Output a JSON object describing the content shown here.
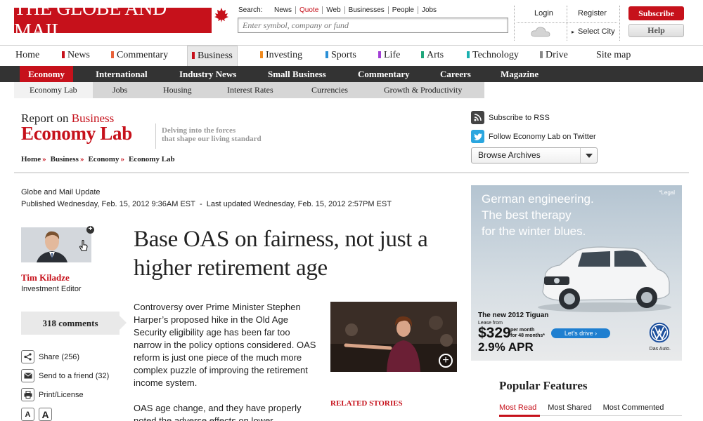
{
  "header": {
    "logo": "THE GLOBE AND MAIL",
    "search_label": "Search:",
    "search_tabs": [
      "News",
      "Quote",
      "Web",
      "Businesses",
      "People",
      "Jobs"
    ],
    "search_active": "Quote",
    "search_placeholder": "Enter symbol, company or fund",
    "login": "Login",
    "register": "Register",
    "select_city": "Select City",
    "subscribe": "Subscribe",
    "help": "Help"
  },
  "section_nav": {
    "items": [
      {
        "label": "Home"
      },
      {
        "label": "News",
        "color": "#c6111b"
      },
      {
        "label": "Commentary",
        "color": "#e8623a"
      },
      {
        "label": "Business",
        "color": "#c6111b"
      },
      {
        "label": "Investing",
        "color": "#f08a1e"
      },
      {
        "label": "Sports",
        "color": "#2a8fd6"
      },
      {
        "label": "Life",
        "color": "#a23fd6"
      },
      {
        "label": "Arts",
        "color": "#1fa67a"
      },
      {
        "label": "Technology",
        "color": "#1ab0b0"
      },
      {
        "label": "Drive",
        "color": "#888888"
      },
      {
        "label": "Site map"
      }
    ],
    "selected": "Business"
  },
  "sub_nav": {
    "items": [
      "Economy",
      "International",
      "Industry News",
      "Small Business",
      "Commentary",
      "Careers",
      "Magazine"
    ],
    "selected": "Economy"
  },
  "third_nav": {
    "items": [
      "Economy Lab",
      "Jobs",
      "Housing",
      "Interest Rates",
      "Currencies",
      "Growth & Productivity"
    ],
    "selected": "Economy Lab"
  },
  "page_header": {
    "report_on": "Report on",
    "business": "Business",
    "title": "Economy Lab",
    "tagline_1": "Delving into the forces",
    "tagline_2": "that shape our living standard",
    "breadcrumb": [
      "Home",
      "Business",
      "Economy",
      "Economy Lab"
    ],
    "rss": "Subscribe to RSS",
    "twitter": "Follow Economy Lab on Twitter",
    "archives": "Browse Archives"
  },
  "article": {
    "source": "Globe and Mail Update",
    "published": "Published Wednesday, Feb. 15, 2012 9:36AM EST",
    "separator": "-",
    "updated": "Last updated Wednesday, Feb. 15, 2012 2:57PM EST",
    "author": "Tim Kiladze",
    "role": "Investment Editor",
    "comments": "318 comments",
    "tools": [
      {
        "label": "Share (256)",
        "icon": "share-icon"
      },
      {
        "label": "Send to a friend (32)",
        "icon": "envelope-icon"
      },
      {
        "label": "Print/License",
        "icon": "print-icon"
      }
    ],
    "font_small": "A",
    "font_large": "A",
    "headline": "Base OAS on fairness, not just a higher retirement age",
    "paragraphs": [
      "Controversy over Prime Minister Stephen Harper’s proposed hike in the Old Age Security eligibility age has been far too narrow in the policy options considered. OAS reform is just one piece of the much more complex puzzle of improving the retirement income system.",
      "OAS age change, and they have properly noted the adverse effects on lower"
    ],
    "related": "RELATED STORIES"
  },
  "ad": {
    "headline_1": "German engineering.",
    "headline_2": "The best therapy",
    "headline_3": "for the winter blues.",
    "legal": "*Legal",
    "model": "The new 2012 Tiguan",
    "lease_from": "Lease from",
    "price": "$329",
    "per_month_1": "per month",
    "per_month_2": "for 48 months*",
    "apr": "2.9% APR",
    "cta": "Let's drive ›",
    "brand": "Das Auto."
  },
  "popular": {
    "title": "Popular Features",
    "tabs": [
      "Most Read",
      "Most Shared",
      "Most Commented"
    ],
    "selected": "Most Read"
  },
  "colors": {
    "brand_red": "#c6111b",
    "dark_bar": "#333333"
  }
}
